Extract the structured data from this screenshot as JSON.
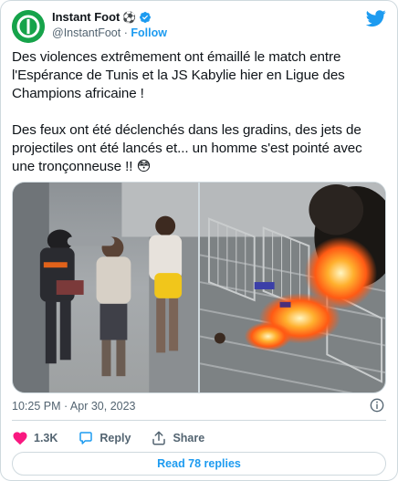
{
  "author": {
    "name": "Instant Foot",
    "name_emoji": "⚽",
    "handle": "@InstantFoot",
    "separator": "·",
    "follow_label": "Follow",
    "avatar_icon": "instant-foot-logo",
    "avatar_color": "#16a34a",
    "verified_icon": "verified-badge"
  },
  "tweet": {
    "text": "Des violences extrêmement ont émaillé le match entre l'Espérance de Tunis et la JS Kabylie hier en Ligue des Champions africaine !\n\nDes feux ont été déclenchés dans les gradins, des jets de projectiles ont été lancés et... un homme s'est pointé avec une tronçonneuse !! 😳",
    "timestamp": "10:25 PM · Apr 30, 2023"
  },
  "media": {
    "photos": [
      {
        "icon": "photo-fight-in-stands"
      },
      {
        "icon": "photo-fire-on-stairs"
      }
    ]
  },
  "actions": {
    "like_count": "1.3K",
    "reply_label": "Reply",
    "share_label": "Share"
  },
  "read_replies_label": "Read 78 replies",
  "colors": {
    "accent": "#1d9bf0",
    "like": "#f91880",
    "secondary_text": "#536471",
    "border": "#cfd9de"
  }
}
